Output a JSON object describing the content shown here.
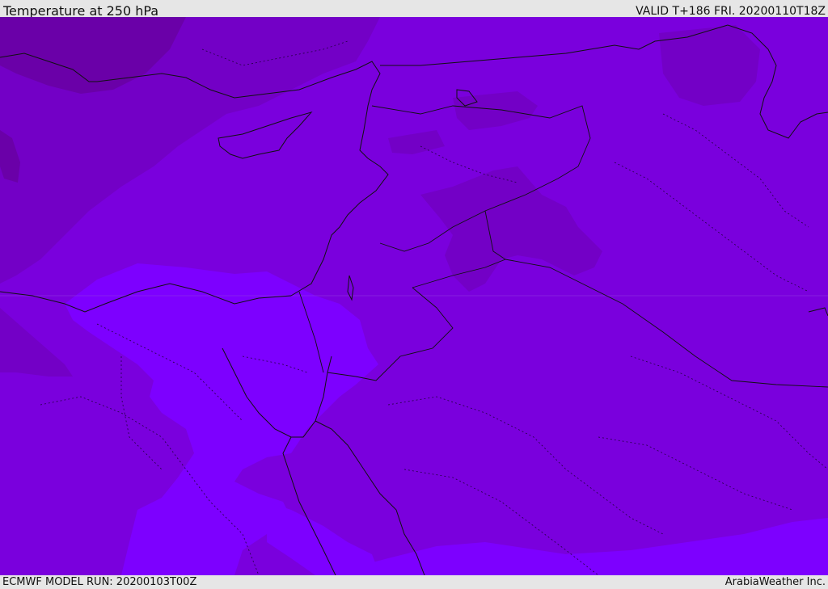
{
  "header": {
    "title": "Temperature at 250 hPa",
    "valid": "VALID T+186 FRI. 20200110T18Z"
  },
  "footer": {
    "model_run": "ECMWF MODEL RUN: 20200103T00Z",
    "credit": "ArabiaWeather Inc."
  },
  "map": {
    "variable": "temperature",
    "level": "250 hPa",
    "colors": {
      "coldest": "#6a00a8",
      "cold": "#7300c6",
      "base": "#7a00dd",
      "warm": "#8000f0",
      "warmest": "#7d00ff"
    },
    "region_labels": []
  }
}
